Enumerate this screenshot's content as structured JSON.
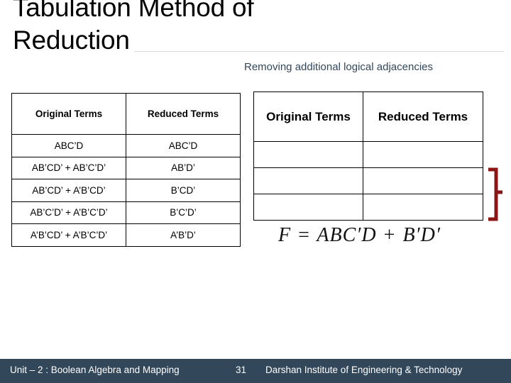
{
  "slide": {
    "title_line1": "Tabulation Method of",
    "title_line2": "Reduction",
    "subtitle": "Removing additional logical adjacencies"
  },
  "left_table": {
    "headers": [
      "Original Terms",
      "Reduced Terms"
    ],
    "rows": [
      {
        "original": "ABC’D",
        "reduced": "ABC’D"
      },
      {
        "original": "AB’CD’ + AB’C’D’",
        "reduced": "AB’D’"
      },
      {
        "original": "AB’CD’ + A’B’CD’",
        "reduced": "B’CD’"
      },
      {
        "original": "AB’C’D’ + A’B’C’D’",
        "reduced": "B’C’D’"
      },
      {
        "original": "A’B’CD’ + A’B’C’D’",
        "reduced": "A’B’D’"
      }
    ]
  },
  "right_table": {
    "headers": [
      "Original Terms",
      "Reduced Terms"
    ],
    "rows": [
      {
        "original": "",
        "reduced": ""
      },
      {
        "original": "",
        "reduced": ""
      },
      {
        "original": "",
        "reduced": ""
      }
    ]
  },
  "equation": {
    "lhs": "F",
    "equals": "=",
    "term1": "ABC′D",
    "plus": "+",
    "term2": "B′D′",
    "full": "F = ABC′D + B′D′"
  },
  "annotation": {
    "brace_color": "#8B1616"
  },
  "footer": {
    "unit": "Unit – 2 : Boolean Algebra and Mapping",
    "page": "31",
    "institute": "Darshan Institute of Engineering & Technology",
    "background": "#33475b"
  }
}
